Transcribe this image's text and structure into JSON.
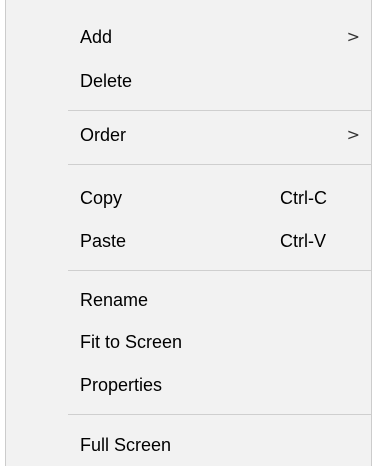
{
  "context_menu": {
    "groups": [
      {
        "items": [
          {
            "label": "Add",
            "submenu_indicator": ">"
          },
          {
            "label": "Delete"
          }
        ]
      },
      {
        "items": [
          {
            "label": "Order",
            "submenu_indicator": ">"
          }
        ]
      },
      {
        "items": [
          {
            "label": "Copy",
            "shortcut": "Ctrl-C"
          },
          {
            "label": "Paste",
            "shortcut": "Ctrl-V"
          }
        ]
      },
      {
        "items": [
          {
            "label": "Rename"
          },
          {
            "label": "Fit to Screen"
          },
          {
            "label": "Properties"
          }
        ]
      },
      {
        "items": [
          {
            "label": "Full Screen"
          }
        ]
      }
    ]
  }
}
